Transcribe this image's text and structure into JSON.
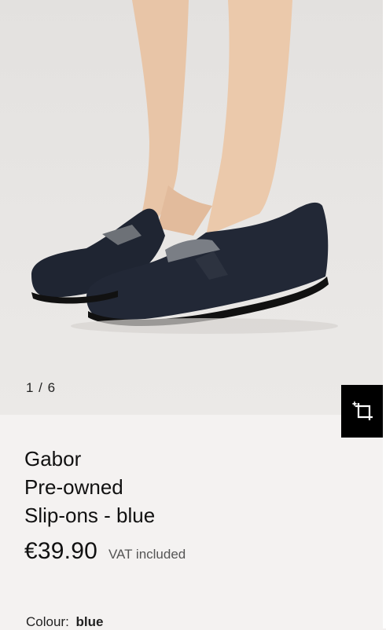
{
  "gallery": {
    "counter": "1 / 6",
    "image_icon": "product-photo-shoes",
    "crop_icon": "crop-rotate-icon"
  },
  "product": {
    "brand": "Gabor",
    "title_line1": "Pre-owned",
    "title_line2": "Slip-ons - blue",
    "price": "€39.90",
    "vat_note": "VAT included",
    "colour_label": "Colour:",
    "colour_value": "blue"
  },
  "colors": {
    "background": "#f4f2f1",
    "photo_bg": "#e6e4e2",
    "shoe": "#1e2430",
    "skin": "#e7c3a4",
    "button_bg": "#000000"
  }
}
